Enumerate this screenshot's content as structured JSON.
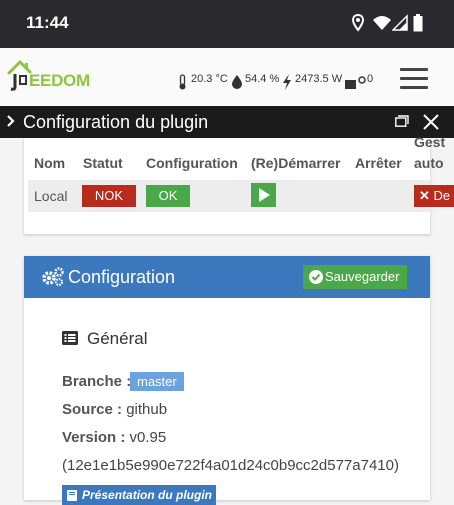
{
  "status_bar": {
    "time": "11:44",
    "icons": [
      "location-icon",
      "wifi-icon",
      "signal-icon",
      "battery-icon"
    ]
  },
  "header": {
    "logo_text": "EEDOM",
    "temperature": "20.3 °C",
    "humidity": "54.4 %",
    "power": "2473.5 W",
    "devices": "0"
  },
  "dialog": {
    "title": "Configuration du plugin"
  },
  "table": {
    "headers": [
      "Nom",
      "Statut",
      "Configuration",
      "(Re)Démarrer",
      "Arrêter",
      "Gest",
      "auto"
    ],
    "row": {
      "name": "Local",
      "status": "NOK",
      "configuration": "OK",
      "restart_icon": "play-icon",
      "auto_button": "De"
    }
  },
  "config": {
    "title": "Configuration",
    "save_label": "Sauvegarder",
    "section_title": "Général",
    "branch_label": "Branche :",
    "branch_value": "master",
    "source_label": "Source :",
    "source_value": "github",
    "version_label": "Version :",
    "version_value": "v0.95",
    "commit": "(12e1e1b5e990e722f4a01d24c0b9cc2d577a7410)",
    "presentation_label": "Présentation du plugin"
  },
  "colors": {
    "status_bar": "#29292e",
    "logo_green": "#8dc63f",
    "danger": "#b72c1d",
    "success": "#4aa84b",
    "primary": "#3b78bd",
    "badge": "#6aa3de"
  }
}
